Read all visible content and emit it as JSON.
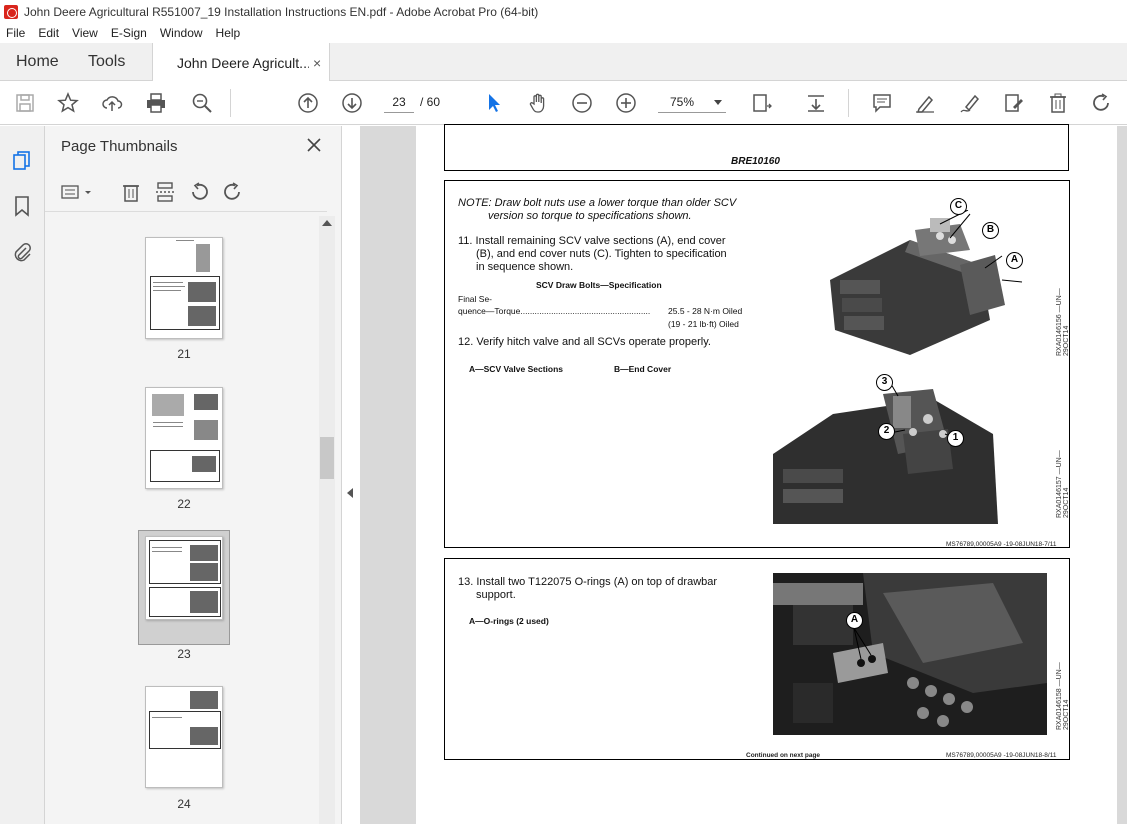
{
  "window": {
    "title": "John Deere Agricultural R551007_19 Installation Instructions EN.pdf - Adobe Acrobat Pro (64-bit)"
  },
  "menu": [
    "File",
    "Edit",
    "View",
    "E-Sign",
    "Window",
    "Help"
  ],
  "tabs": {
    "home": "Home",
    "tools": "Tools",
    "document": "John Deere Agricult...",
    "close": "×"
  },
  "toolbar": {
    "current_page": "23",
    "page_total": "/ 60",
    "zoom": "75%"
  },
  "panel": {
    "title": "Page Thumbnails",
    "close": "×"
  },
  "thumbnails": [
    {
      "label": "21"
    },
    {
      "label": "22"
    },
    {
      "label": "23",
      "selected": true
    },
    {
      "label": "24"
    }
  ],
  "document": {
    "header_code": "BRE10160",
    "section1": {
      "note": "NOTE: Draw bolt nuts use a lower torque than older SCV",
      "note2": "version so torque to specifications shown.",
      "step11_a": "11. Install remaining SCV valve sections (A), end cover",
      "step11_b": "(B), and end cover nuts (C). Tighten to specification",
      "step11_c": "in sequence shown.",
      "spec_title": "SCV Draw Bolts—Specification",
      "spec_label1": "Final    Se-",
      "spec_label2": "quence—Torque.......................................................",
      "spec_value1": "25.5 - 28 N·m Oiled",
      "spec_value2": "(19 - 21 lb·ft) Oiled",
      "step12": "12. Verify hitch valve and all SCVs operate properly.",
      "legend_a": "A—SCV Valve Sections",
      "legend_b": "B—End Cover",
      "callouts_top": [
        "C",
        "B",
        "A"
      ],
      "callouts_bottom": [
        "3",
        "2",
        "1"
      ],
      "img_code1": "RXA0146156 —UN—29OCT14",
      "img_code2": "RXA0146157 —UN—29OCT14",
      "footer": "MS76789,00005A9 -19-08JUN18-7/11"
    },
    "section2": {
      "step13_a": "13. Install two T122075 O-rings (A) on top of drawbar",
      "step13_b": "support.",
      "legend_a": "A—O-rings (2 used)",
      "callout": "A",
      "img_code": "RXA0146158 —UN—29OCT14",
      "continued": "Continued on next page",
      "footer": "MS76789,00005A9 -19-08JUN18-8/11"
    }
  }
}
